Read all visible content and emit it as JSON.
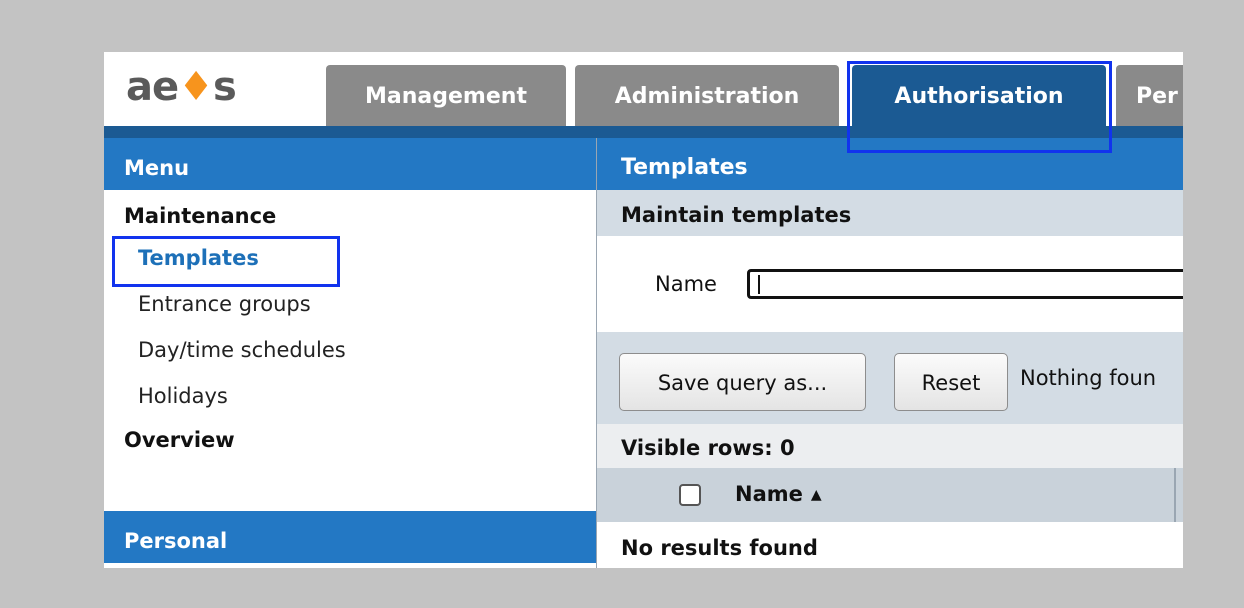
{
  "app": {
    "logo_text": "ae",
    "logo_mark": "♦",
    "logo_tail": "s"
  },
  "tabs": [
    {
      "label": "Management",
      "active": false
    },
    {
      "label": "Administration",
      "active": false
    },
    {
      "label": "Authorisation",
      "active": true
    },
    {
      "label": "Per",
      "active": false
    }
  ],
  "menu": {
    "title": "Menu",
    "groups": [
      {
        "label": "Maintenance",
        "items": [
          {
            "label": "Templates",
            "selected": true
          },
          {
            "label": "Entrance groups",
            "selected": false
          },
          {
            "label": "Day/time schedules",
            "selected": false
          },
          {
            "label": "Holidays",
            "selected": false
          }
        ]
      },
      {
        "label": "Overview",
        "items": []
      }
    ],
    "personal_title": "Personal"
  },
  "content": {
    "title": "Templates",
    "subtitle": "Maintain templates",
    "filter": {
      "name_label": "Name",
      "name_value": ""
    },
    "actions": {
      "save_query_label": "Save query as...",
      "reset_label": "Reset",
      "status_text": "Nothing foun"
    },
    "visible_rows": "Visible rows: 0",
    "table": {
      "columns": [
        {
          "label": "Name",
          "sort": "ascending"
        }
      ]
    },
    "no_results": "No results found"
  },
  "colors": {
    "accent": "#2378c4",
    "tab_active": "#1b5a93",
    "tab_inactive": "#8a8a8a",
    "highlight": "#1133ee",
    "logo_orange": "#f7941d"
  }
}
